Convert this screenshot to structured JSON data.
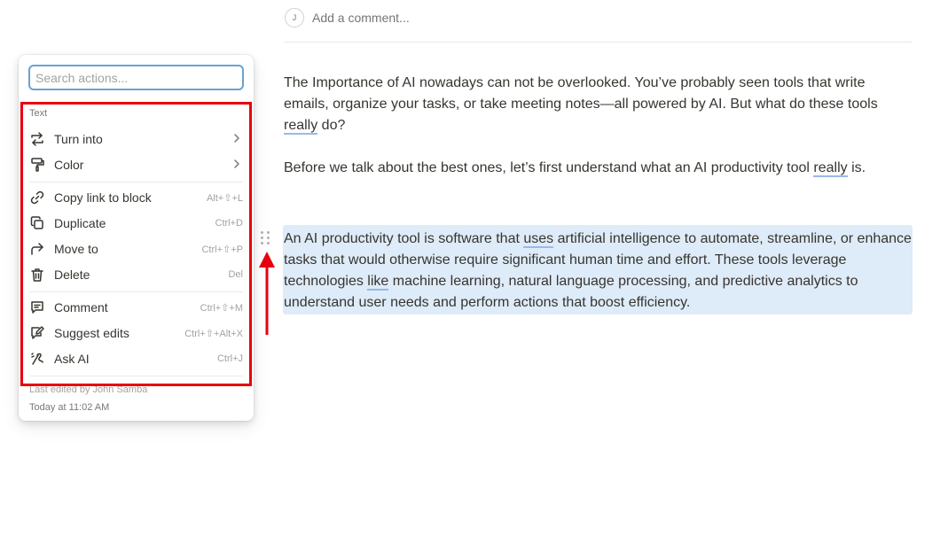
{
  "comment": {
    "avatar_initial": "J",
    "placeholder": "Add a comment..."
  },
  "document": {
    "p1": {
      "before": "The Importance of AI nowadays can not be overlooked.  You’ve probably seen tools that write emails, organize your tasks, or take meeting notes—all powered by AI. But what do these tools ",
      "underlined": "really",
      "after": " do?"
    },
    "p2": {
      "before": " Before we talk about the best ones, let’s first understand what an AI productivity tool ",
      "underlined": "really",
      "after": " is."
    },
    "p3": {
      "part1": "An AI productivity tool is software that ",
      "u1": "uses",
      "part2": " artificial intelligence to automate, streamline, or enhance tasks that would otherwise require significant human time and effort. These tools leverage technologies ",
      "u2": "like",
      "part3": " machine learning, natural language processing, and predictive analytics to understand user needs and perform actions that boost efficiency."
    }
  },
  "menu": {
    "search_placeholder": "Search actions...",
    "section_label": "Text",
    "items": [
      {
        "label": "Turn into",
        "icon": "turn-into-icon",
        "submenu": true
      },
      {
        "label": "Color",
        "icon": "paint-roller-icon",
        "submenu": true
      },
      {
        "label": "Copy link to block",
        "icon": "link-icon",
        "shortcut": "Alt+⇧+L"
      },
      {
        "label": "Duplicate",
        "icon": "duplicate-icon",
        "shortcut": "Ctrl+D"
      },
      {
        "label": "Move to",
        "icon": "move-to-icon",
        "shortcut": "Ctrl+⇧+P"
      },
      {
        "label": "Delete",
        "icon": "trash-icon",
        "shortcut": "Del"
      },
      {
        "label": "Comment",
        "icon": "comment-icon",
        "shortcut": "Ctrl+⇧+M"
      },
      {
        "label": "Suggest edits",
        "icon": "suggest-edits-icon",
        "shortcut": "Ctrl+⇧+Alt+X"
      },
      {
        "label": "Ask AI",
        "icon": "ai-icon",
        "shortcut": "Ctrl+J"
      }
    ],
    "last_edited_by": "Last edited by John Samba",
    "last_edited_time": "Today at 11:02 AM"
  },
  "colors": {
    "highlight": "#deebf8",
    "annotation_red": "#e8000f",
    "focus_blue": "#6aa0d8"
  }
}
